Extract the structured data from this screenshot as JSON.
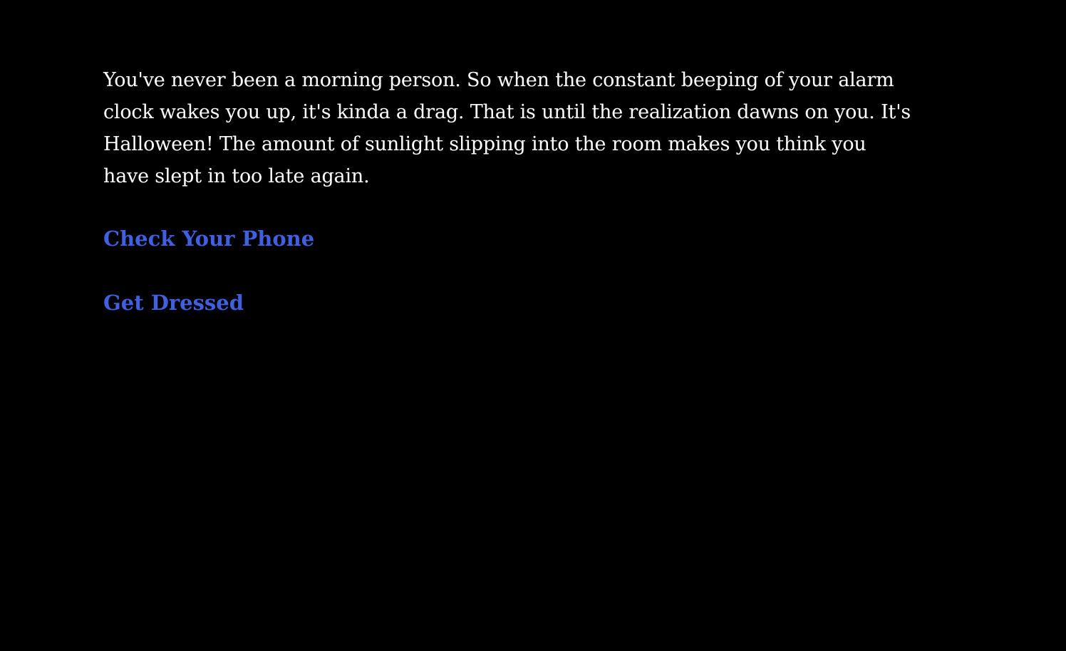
{
  "passage": {
    "text": "You've never been a morning person. So when the constant beeping of your alarm clock wakes you up, it's kinda a drag. That is until the realization dawns on you. It's Halloween! The amount of sunlight slipping into the room makes you think you have slept in too late again."
  },
  "choices": [
    {
      "label": "Check Your Phone"
    },
    {
      "label": "Get Dressed"
    }
  ],
  "colors": {
    "background": "#000000",
    "text": "#ffffff",
    "link": "#4060e0"
  }
}
